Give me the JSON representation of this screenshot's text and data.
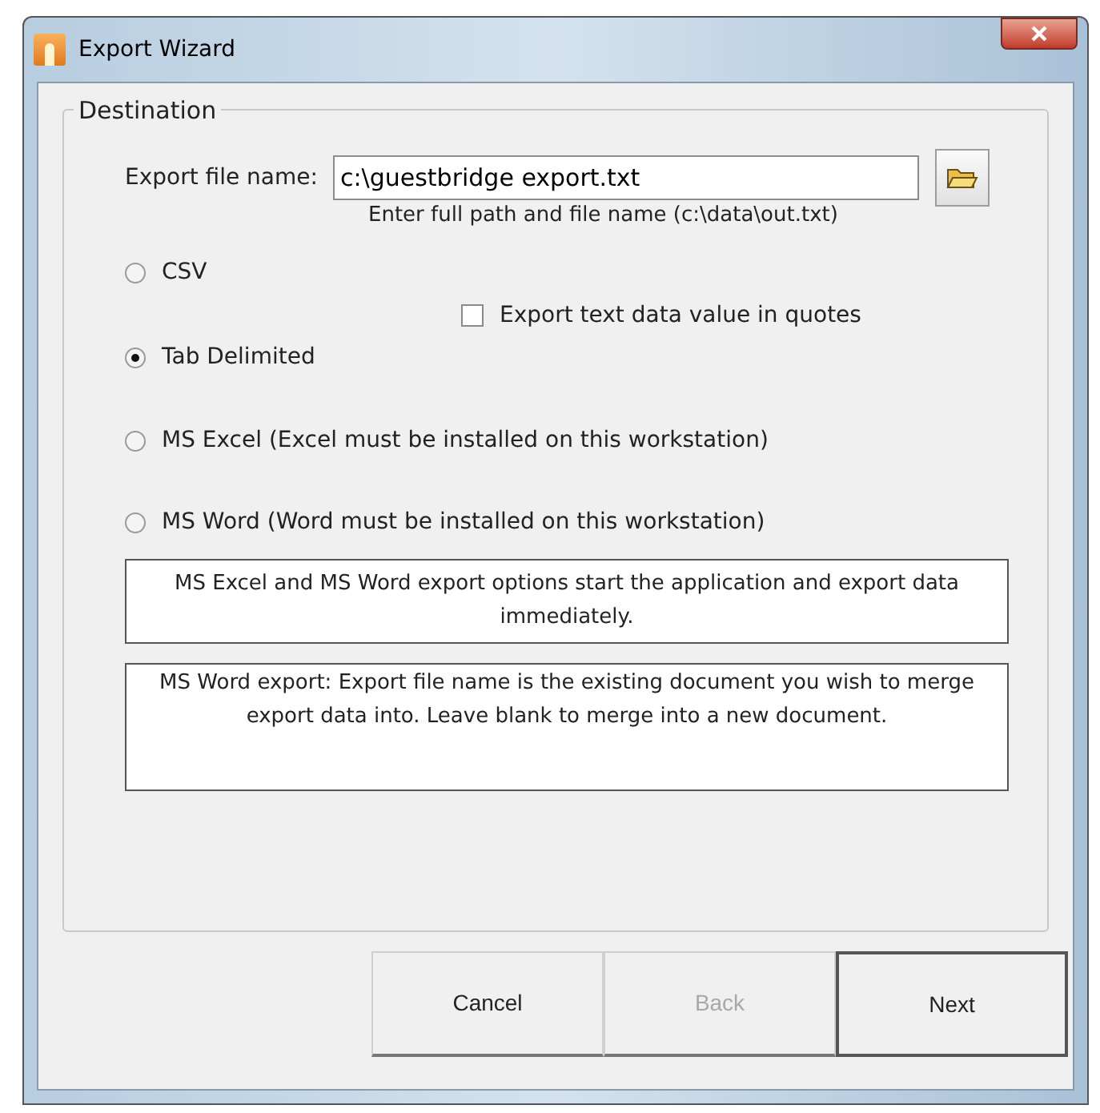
{
  "window": {
    "title": "Export Wizard"
  },
  "destination": {
    "legend": "Destination",
    "file_label": "Export file name:",
    "file_value": "c:\\guestbridge export.txt",
    "hint": "Enter full path and file name (c:\\data\\out.txt)",
    "formats": [
      {
        "label": "CSV",
        "selected": false
      },
      {
        "label": "Tab Delimited",
        "selected": true
      },
      {
        "label": "MS Excel (Excel must be installed on this workstation)",
        "selected": false
      },
      {
        "label": "MS Word (Word must be installed on this workstation)",
        "selected": false
      }
    ],
    "quotes_option": {
      "label": "Export text data value in quotes",
      "checked": false
    },
    "notes": [
      "MS Excel and MS Word export options start the application and export data immediately.",
      "MS Word export: Export file name is the existing document you wish to merge export data into. Leave blank to merge into a new document."
    ]
  },
  "buttons": [
    {
      "label": "Cancel",
      "disabled": false,
      "default": false
    },
    {
      "label": "Back",
      "disabled": true,
      "default": false
    },
    {
      "label": "Next",
      "disabled": false,
      "default": true
    }
  ]
}
